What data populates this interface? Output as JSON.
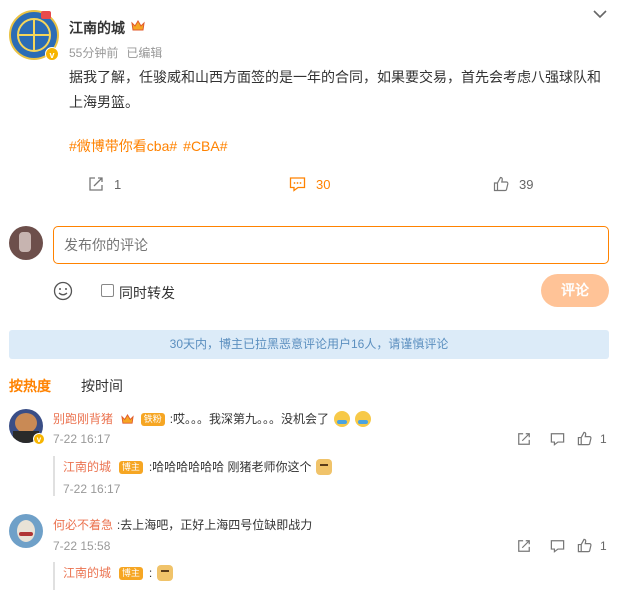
{
  "post": {
    "author": "江南的城",
    "time": "55分钟前",
    "edited": "已编辑",
    "text": "据我了解，任骏威和山西方面签的是一年的合同，如果要交易，首先会考虑八强球队和上海男篮。",
    "topics": [
      "#微博带你看cba#",
      "#CBA#"
    ],
    "actions": {
      "repost": "1",
      "comments": "30",
      "likes": "39"
    }
  },
  "composer": {
    "placeholder": "发布你的评论",
    "repost_label": "同时转发",
    "submit_label": "评论"
  },
  "notice": "30天内，博主已拉黑恶意评论用户16人，请谨慎评论",
  "sort": {
    "hot": "按热度",
    "time": "按时间"
  },
  "comments": [
    {
      "name": "别跑刚背猪",
      "fan_badge": "铁粉",
      "text": ":哎。。。我深第九。。。没机会了",
      "time": "7-22 16:17",
      "likes": "1",
      "reply": {
        "name": "江南的城",
        "badge": "博主",
        "text": ":哈哈哈哈哈哈 刚猪老师你这个",
        "time": "7-22 16:17"
      }
    },
    {
      "name": "何必不着急",
      "text": ":去上海吧，正好上海四号位缺即战力",
      "time": "7-22 15:58",
      "likes": "1",
      "reply": {
        "name": "江南的城",
        "badge": "博主",
        "text": ":"
      }
    }
  ],
  "colors": {
    "accent": "#ff8200",
    "name": "#eb7350",
    "notice_bg": "#dcebf8",
    "notice_text": "#5b8fbf"
  },
  "icons": [
    "chevron-down-icon",
    "repost-icon",
    "comment-icon",
    "like-icon",
    "emoji-icon",
    "share-icon",
    "reply-icon"
  ]
}
